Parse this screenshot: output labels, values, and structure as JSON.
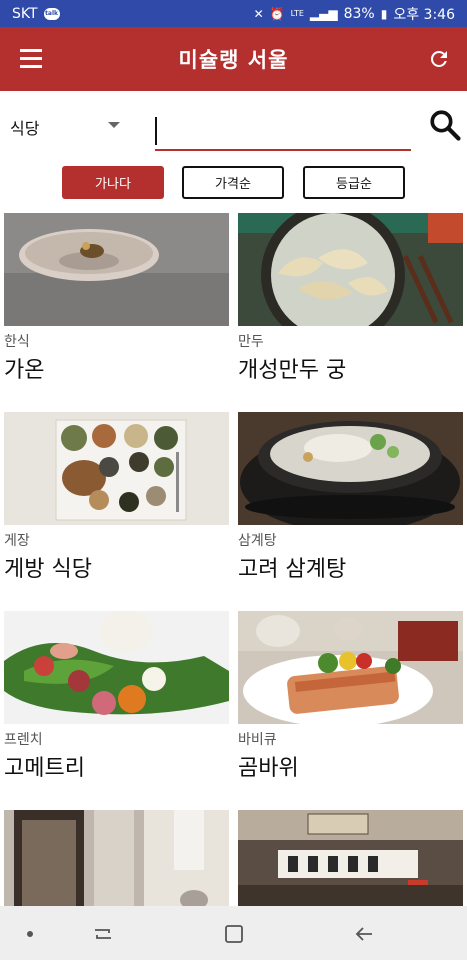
{
  "status_bar": {
    "carrier": "SKT",
    "chat_badge": "talk",
    "network": "LTE",
    "battery": "83%",
    "time": "오후 3:46"
  },
  "app_bar": {
    "title": "미슐랭 서울",
    "menu_icon": "hamburger-menu-icon",
    "refresh_icon": "refresh-icon"
  },
  "search": {
    "category": "식당",
    "value": "",
    "placeholder": ""
  },
  "sort": {
    "options": [
      "가나다",
      "가격순",
      "등급순"
    ],
    "active": "가나다"
  },
  "restaurants": [
    {
      "category": "한식",
      "name": "가온"
    },
    {
      "category": "만두",
      "name": "개성만두 궁"
    },
    {
      "category": "게장",
      "name": "게방 식당"
    },
    {
      "category": "삼계탕",
      "name": "고려 삼계탕"
    },
    {
      "category": "프렌치",
      "name": "고메트리"
    },
    {
      "category": "바비큐",
      "name": "곰바위"
    },
    {
      "category": "",
      "name": ""
    },
    {
      "category": "",
      "name": ""
    }
  ],
  "colors": {
    "primary": "#b4302f",
    "status_bar": "#2f4aa8",
    "nav_bar": "#eeeeee"
  }
}
